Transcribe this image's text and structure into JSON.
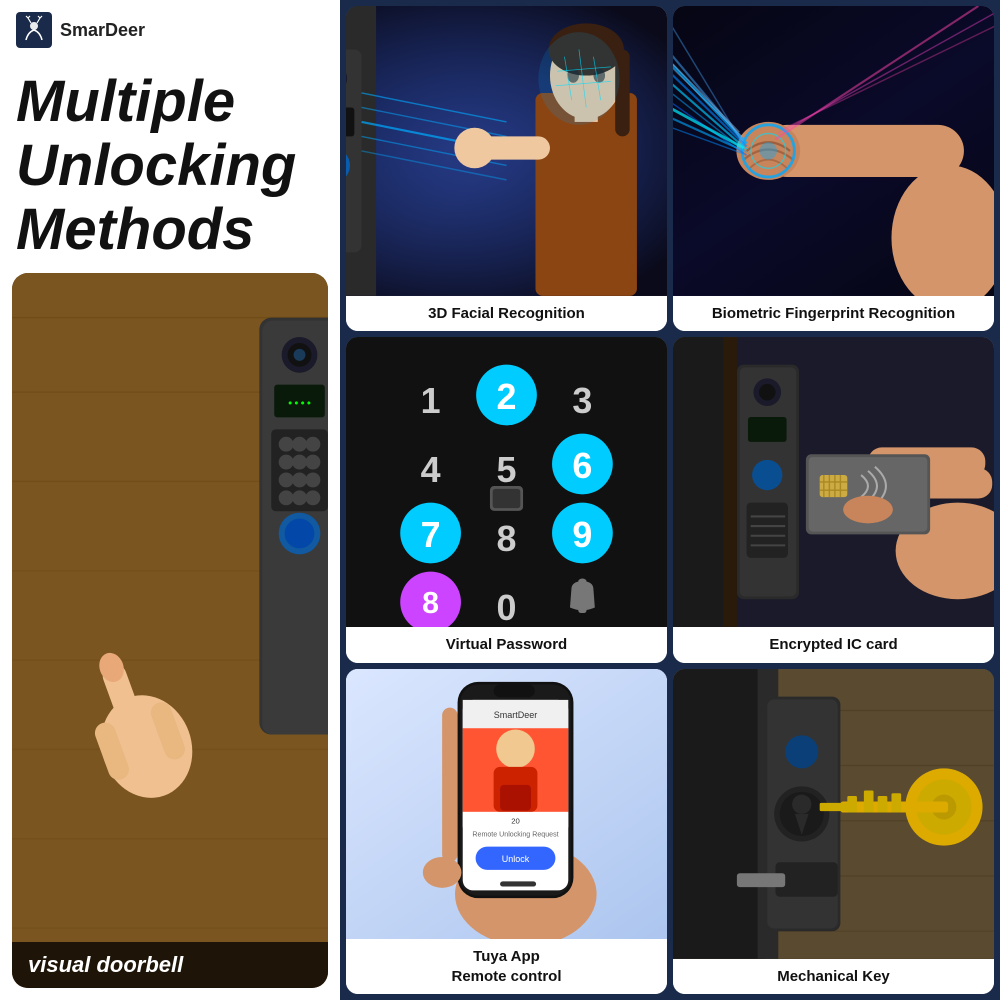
{
  "brand": {
    "name": "SmarDeer",
    "logo_alt": "SmarDeer logo"
  },
  "left": {
    "headline_line1": "Multiple",
    "headline_line2": "Unlocking",
    "headline_line3": "Methods",
    "doorbell_label": "visual doorbell"
  },
  "methods": [
    {
      "id": "facial",
      "label": "3D Facial Recognition",
      "col": 1,
      "row": 1
    },
    {
      "id": "fingerprint",
      "label": "Biometric Fingerprint Recognition",
      "col": 2,
      "row": 1
    },
    {
      "id": "password",
      "label": "Virtual Password",
      "col": 1,
      "row": 2
    },
    {
      "id": "iccard",
      "label": "Encrypted IC card",
      "col": 2,
      "row": 2
    },
    {
      "id": "tuya",
      "label": "Tuya App\nRemote control",
      "label_line1": "Tuya App",
      "label_line2": "Remote control",
      "col": 1,
      "row": 3
    },
    {
      "id": "mechkey",
      "label": "Mechanical Key",
      "col": 2,
      "row": 3
    }
  ],
  "numpad": {
    "keys": [
      "1",
      "2",
      "3",
      "4",
      "5",
      "6",
      "7",
      "8",
      "9",
      "8",
      "0",
      "🔔"
    ],
    "colors": [
      "normal",
      "cyan",
      "normal",
      "normal",
      "normal",
      "cyan",
      "cyan",
      "normal",
      "cyan",
      "purple",
      "normal",
      "icon"
    ]
  }
}
